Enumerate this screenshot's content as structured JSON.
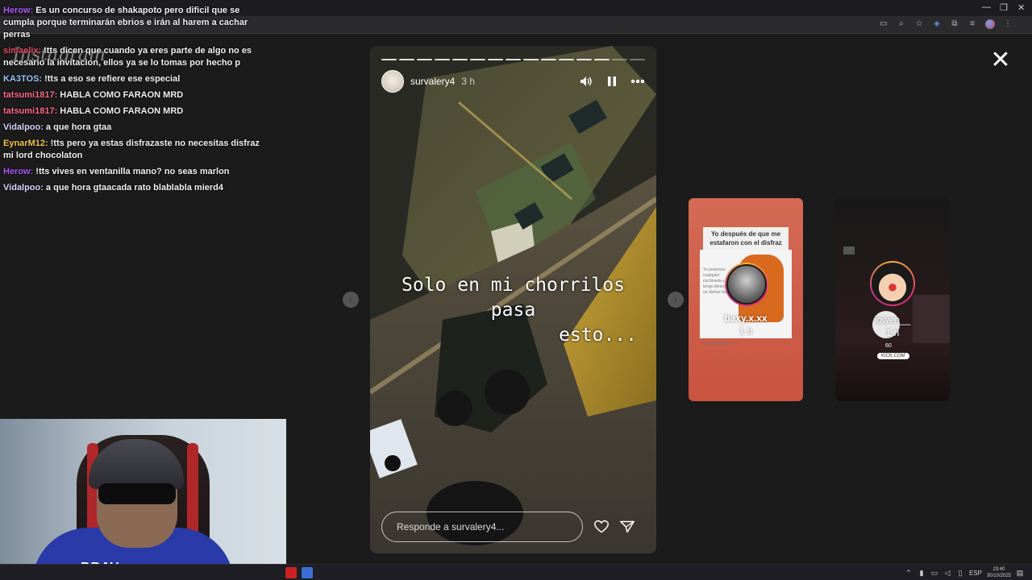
{
  "browser": {
    "window_controls": [
      "—",
      "❐",
      "✕"
    ]
  },
  "instagram_logo": "Instagram",
  "chat": [
    {
      "user": "Herow:",
      "color": "#b05cff",
      "text": "Es un concurso de shakapoto pero dificil que se cumpla porque terminarán ebrios e irán al harem a cachar perras"
    },
    {
      "user": "simaelix:",
      "color": "#e0526b",
      "text": "!tts dicen que cuando ya eres parte de algo no es necesario la invitacion, ellos ya se lo tomas por hecho p"
    },
    {
      "user": "KA3TOS:",
      "color": "#9ec6ff",
      "text": "!tts a eso se refiere ese especial"
    },
    {
      "user": "tatsumi1817:",
      "color": "#ff6b8a",
      "text": "HABLA COMO FARAON MRD"
    },
    {
      "user": "tatsumi1817:",
      "color": "#ff6b8a",
      "text": "HABLA COMO FARAON MRD"
    },
    {
      "user": "Vidalpoo:",
      "color": "#dcd6ff",
      "text": "a que hora gtaa"
    },
    {
      "user": "EynarM12:",
      "color": "#f2c94c",
      "text": "!tts pero ya estas disfrazaste no necesitas disfraz mi lord chocolaton"
    },
    {
      "user": "Herow:",
      "color": "#b05cff",
      "text": "!tts vives en ventanilla mano? no seas marlon"
    },
    {
      "user": "Vidalpoo:",
      "color": "#dcd6ff",
      "text": "a que hora gtaacada rato blablabla mierd4"
    }
  ],
  "story": {
    "username": "survalery4",
    "time": "3 h",
    "progress_total": 15,
    "progress_viewed": 13,
    "caption_line1": "Solo en mi chorrilos pasa",
    "caption_line2": "esto...",
    "reply_placeholder": "Responde a survalery4..."
  },
  "icons": {
    "close": "✕",
    "prev": "‹",
    "next": "›"
  },
  "previews": [
    {
      "username": "baxy.x.xx",
      "time": "1 h",
      "heading": "Yo después de que me estafaron con el disfraz",
      "side_text": "Yo ponemos cualquier cochinada y no tengo dinero para un disfraz bueno",
      "handle": "@lacolchetamire"
    },
    {
      "username": "iowen__",
      "time": "1 h",
      "badge": "60",
      "kick": "KICK.COM"
    }
  ],
  "webcam": {
    "shirt_text": "BRAV"
  },
  "taskbar": {
    "lang": "ESP",
    "time": "23:40",
    "date": "30/10/2025"
  }
}
